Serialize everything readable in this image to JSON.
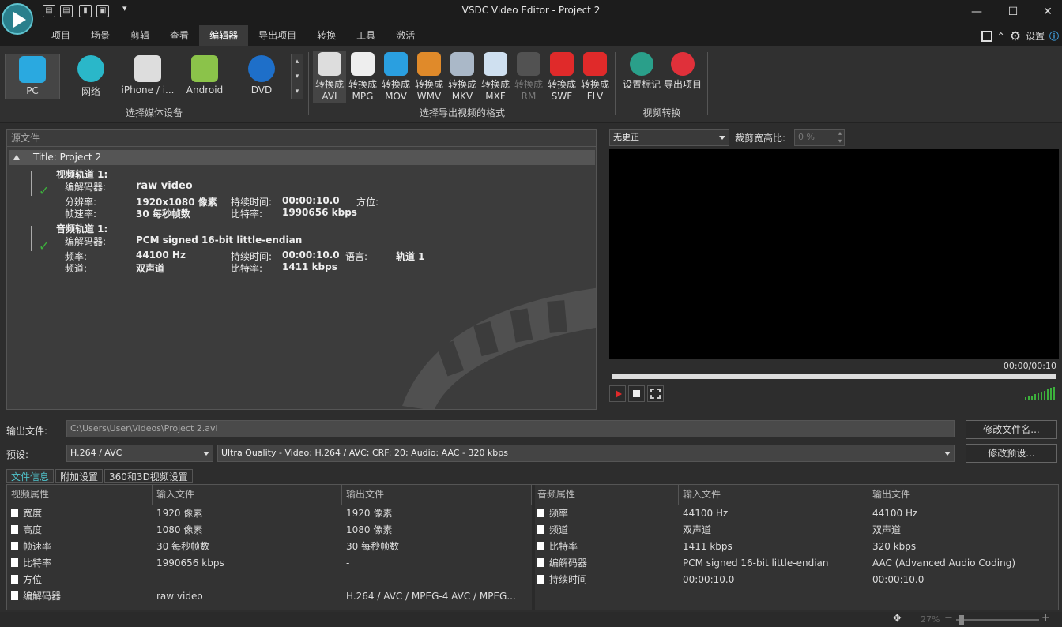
{
  "app": {
    "title": "VSDC Video Editor - Project 2"
  },
  "menu": {
    "tabs": [
      "项目",
      "场景",
      "剪辑",
      "查看",
      "编辑器",
      "导出项目",
      "转换",
      "工具",
      "激活"
    ],
    "active": 4,
    "settings_label": "设置"
  },
  "ribbon": {
    "devices": [
      {
        "label": "PC",
        "icon": "monitor-icon",
        "color": "#2aa9e0"
      },
      {
        "label": "网络",
        "icon": "globe-icon",
        "color": "#2ab7c9"
      },
      {
        "label": "iPhone / i...",
        "icon": "apple-icon",
        "color": "#dddddd"
      },
      {
        "label": "Android",
        "icon": "android-icon",
        "color": "#8bc34a"
      },
      {
        "label": "DVD",
        "icon": "dvd-icon",
        "color": "#1e6fc9"
      }
    ],
    "devices_group_label": "选择媒体设备",
    "formats": [
      {
        "top": "转换成",
        "bottom": "AVI",
        "icon": "film-reel-icon",
        "color": "#dddddd"
      },
      {
        "top": "转换成",
        "bottom": "MPG",
        "icon": "film-icon",
        "color": "#eeeeee"
      },
      {
        "top": "转换成",
        "bottom": "MOV",
        "icon": "quicktime-icon",
        "color": "#2a9fe0"
      },
      {
        "top": "转换成",
        "bottom": "WMV",
        "icon": "wmv-icon",
        "color": "#e08a2a"
      },
      {
        "top": "转换成",
        "bottom": "MKV",
        "icon": "mkv-icon",
        "color": "#aab8c8"
      },
      {
        "top": "转换成",
        "bottom": "MXF",
        "icon": "mxf-icon",
        "color": "#cfe0f0"
      },
      {
        "top": "转换成",
        "bottom": "RM",
        "icon": "realmedia-icon",
        "color": "#888888",
        "disabled": true
      },
      {
        "top": "转换成",
        "bottom": "SWF",
        "icon": "flash-icon",
        "color": "#e02a2a"
      },
      {
        "top": "转换成",
        "bottom": "FLV",
        "icon": "flv-icon",
        "color": "#e02a2a"
      }
    ],
    "formats_group_label": "选择导出视频的格式",
    "actions": [
      {
        "label": "设置标记",
        "icon": "flag-icon",
        "color": "#2a9f8a"
      },
      {
        "label": "导出项目",
        "icon": "rocket-icon",
        "color": "#e0303a"
      }
    ],
    "actions_group_label": "视频转换"
  },
  "source": {
    "header": "源文件",
    "title": "Title: Project 2",
    "video": {
      "track": "视频轨道 1:",
      "codec_label": "编解码器:",
      "codec": "raw video",
      "res_label": "分辨率:",
      "res": "1920x1080 像素",
      "dur_label": "持续时间:",
      "dur": "00:00:10.0",
      "orient_label": "方位:",
      "orient": "-",
      "fps_label": "帧速率:",
      "fps": "30 每秒帧数",
      "bitrate_label": "比特率:",
      "bitrate": "1990656 kbps"
    },
    "audio": {
      "track": "音频轨道 1:",
      "codec_label": "编解码器:",
      "codec": "PCM signed 16-bit little-endian",
      "freq_label": "频率:",
      "freq": "44100 Hz",
      "dur_label": "持续时间:",
      "dur": "00:00:10.0",
      "lang_label": "语言:",
      "lang": "轨道 1",
      "chan_label": "频道:",
      "chan": "双声道",
      "bitrate_label": "比特率:",
      "bitrate": "1411 kbps"
    }
  },
  "preview": {
    "mode": "无更正",
    "crop_label": "裁剪宽高比:",
    "crop_value": "0 %",
    "timecode": "00:00/00:10"
  },
  "output": {
    "file_label": "输出文件:",
    "file_value": "C:\\Users\\User\\Videos\\Project 2.avi",
    "rename_btn": "修改文件名...",
    "preset_label": "预设:",
    "codec": "H.264 / AVC",
    "preset": "Ultra Quality - Video: H.264 / AVC; CRF: 20; Audio: AAC - 320 kbps",
    "edit_preset_btn": "修改预设..."
  },
  "tabs": [
    "文件信息",
    "附加设置",
    "360和3D视频设置"
  ],
  "video_props": {
    "headers": [
      "视频属性",
      "输入文件",
      "输出文件"
    ],
    "rows": [
      [
        "宽度",
        "1920 像素",
        "1920 像素"
      ],
      [
        "高度",
        "1080 像素",
        "1080 像素"
      ],
      [
        "帧速率",
        "30 每秒帧数",
        "30 每秒帧数"
      ],
      [
        "比特率",
        "1990656 kbps",
        "-"
      ],
      [
        "方位",
        "-",
        "-"
      ],
      [
        "编解码器",
        "raw video",
        "H.264 / AVC / MPEG-4 AVC / MPEG..."
      ]
    ]
  },
  "audio_props": {
    "headers": [
      "音频属性",
      "输入文件",
      "输出文件"
    ],
    "rows": [
      [
        "频率",
        "44100 Hz",
        "44100 Hz"
      ],
      [
        "频道",
        "双声道",
        "双声道"
      ],
      [
        "比特率",
        "1411 kbps",
        "320 kbps"
      ],
      [
        "编解码器",
        "PCM signed 16-bit little-endian",
        "AAC (Advanced Audio Coding)"
      ],
      [
        "持续时间",
        "00:00:10.0",
        "00:00:10.0"
      ]
    ]
  },
  "status": {
    "zoom": "27%"
  }
}
